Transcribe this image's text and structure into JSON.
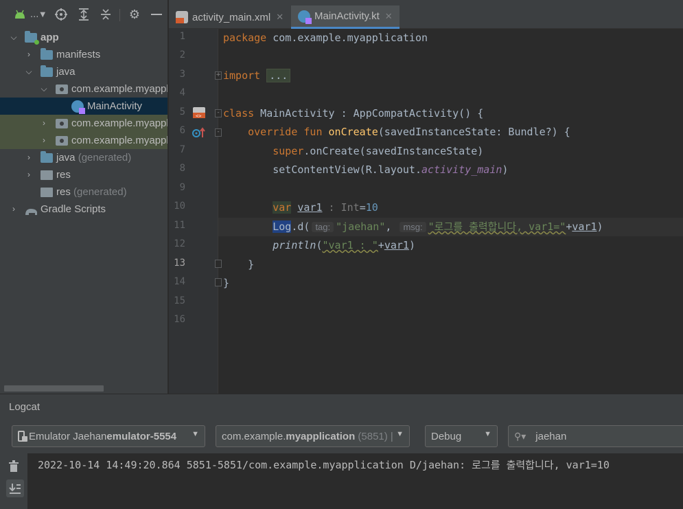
{
  "toolbar": {
    "module_label": "..."
  },
  "project_tree": {
    "rows": [
      {
        "label": "app",
        "suffix": ""
      },
      {
        "label": "manifests",
        "suffix": ""
      },
      {
        "label": "java",
        "suffix": ""
      },
      {
        "label": "com.example.myappl",
        "suffix": ""
      },
      {
        "label": "MainActivity",
        "suffix": ""
      },
      {
        "label": "com.example.myappl",
        "suffix": ""
      },
      {
        "label": "com.example.myappl",
        "suffix": ""
      },
      {
        "label": "java",
        "suffix": "(generated)"
      },
      {
        "label": "res",
        "suffix": ""
      },
      {
        "label": "res",
        "suffix": "(generated)"
      },
      {
        "label": "Gradle Scripts",
        "suffix": ""
      }
    ]
  },
  "tabs": [
    {
      "label": "activity_main.xml",
      "close": "✕"
    },
    {
      "label": "MainActivity.kt",
      "close": "✕"
    }
  ],
  "editor": {
    "line_numbers": [
      "1",
      "2",
      "3",
      "4",
      "5",
      "6",
      "7",
      "8",
      "9",
      "10",
      "11",
      "12",
      "13",
      "14",
      "15",
      "16"
    ],
    "current_line": "13",
    "code": {
      "l1_kw": "package",
      "l1_rest": " com.example.myapplication",
      "l3_kw": "import",
      "l3_fold": "...",
      "l7_kw": "class",
      "l7_rest": " MainActivity : AppCompatActivity() {",
      "l8_kw": "override fun",
      "l8_fn": "onCreate",
      "l8_rest": "(savedInstanceState: Bundle?) {",
      "l9_kw": "super",
      "l9_rest": ".onCreate(savedInstanceState)",
      "l10_a": "setContentView(R.layout.",
      "l10_b": "activity_main",
      "l10_c": ")",
      "l12_kw": "var",
      "l12_var": "var1",
      "l12_type": " : Int",
      "l12_eq": "=",
      "l12_num": "10",
      "l13_log": "Log",
      "l13_a": ".d(",
      "l13_hint_tag": "tag:",
      "l13_str1": "\"jaehan\"",
      "l13_comma": ",",
      "l13_hint_msg": "msg:",
      "l13_str2": "\"로그를 출력합니다, var1=\"",
      "l13_plus": "+",
      "l13_var": "var1",
      "l13_end": ")",
      "l14_fn": "println",
      "l14_a": "(",
      "l14_str": "\"var1 : \"",
      "l14_plus": "+",
      "l14_var": "var1",
      "l14_end": ")",
      "l15": "}",
      "l16": "}"
    }
  },
  "logcat": {
    "title": "Logcat",
    "device_prefix": "Emulator Jaehan ",
    "device_bold": "emulator-5554",
    "process_prefix": "com.example.",
    "process_bold": "myapplication",
    "process_pid": "(5851)",
    "level": "Debug",
    "search_value": "jaehan",
    "log_line": "2022-10-14 14:49:20.864 5851-5851/com.example.myapplication D/jaehan: 로그를 출력합니다, var1=10"
  },
  "colors": {
    "accent": "#4a88c7",
    "keyword": "#cc7832",
    "function": "#ffc66d",
    "string": "#6a8759",
    "number": "#6897bb"
  }
}
